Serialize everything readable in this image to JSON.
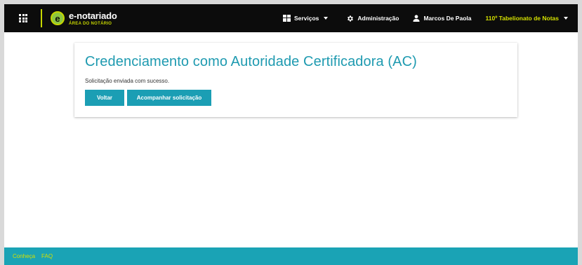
{
  "header": {
    "brand_title": "e-notariado",
    "brand_subtitle": "ÁREA DO NOTÁRIO",
    "logo_letter": "e",
    "nav": {
      "services": "Serviços",
      "admin": "Administração",
      "user": "Marcos De Paola",
      "office": "110º Tabelionato de Notas"
    },
    "colors": {
      "bar": "#0c0c0c",
      "accent": "#c6d600",
      "office_text": "#d4e000"
    }
  },
  "card": {
    "title": "Credenciamento como Autoridade Certificadora (AC)",
    "message": "Solicitação enviada com sucesso.",
    "back_button": "Voltar",
    "track_button": "Acompanhar solicitação",
    "colors": {
      "title": "#1e9ab0",
      "button": "#1b9eb4"
    }
  },
  "footer": {
    "links": [
      "Conheça",
      "FAQ"
    ],
    "colors": {
      "bar": "#1aa3b5",
      "link": "#d4e000"
    }
  },
  "icons": [
    "apps-grid-icon",
    "logo-icon",
    "services-grid-icon",
    "gear-icon",
    "user-icon",
    "chevron-down-icon"
  ]
}
